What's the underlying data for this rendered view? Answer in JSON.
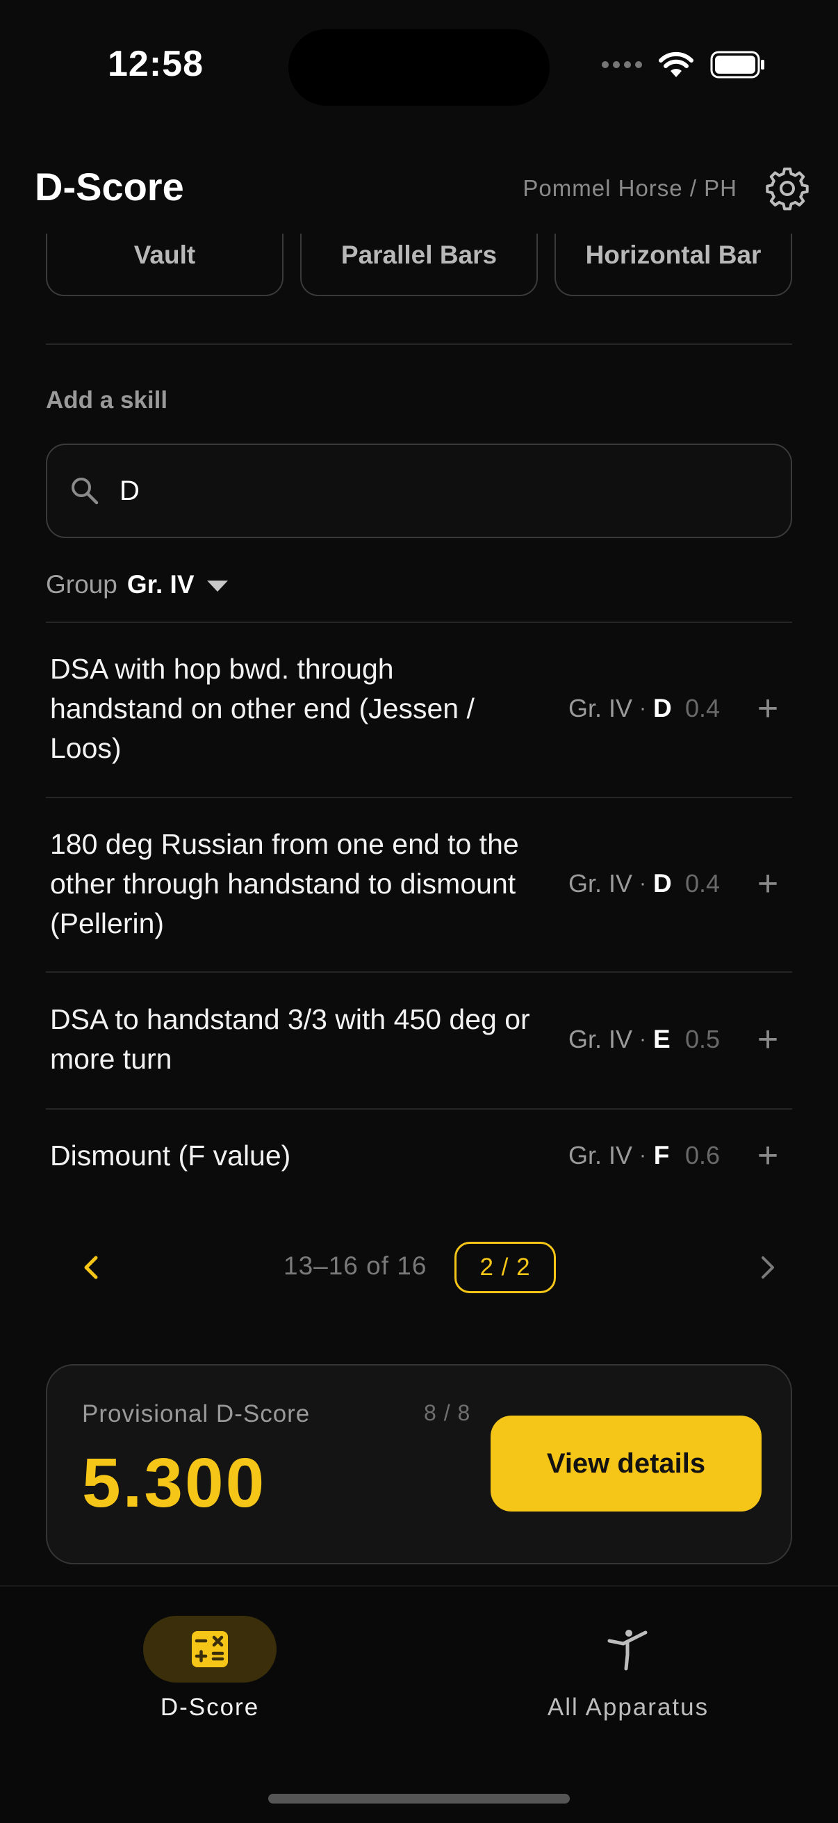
{
  "status_bar": {
    "time": "12:58"
  },
  "header": {
    "title": "D-Score",
    "apparatus": "Pommel Horse / PH"
  },
  "apparatus_tabs": [
    "Vault",
    "Parallel Bars",
    "Horizontal Bar"
  ],
  "add_skill": {
    "label": "Add a skill",
    "search_value": "D",
    "group_label": "Group",
    "group_value": "Gr. IV"
  },
  "skills": [
    {
      "name": "DSA with hop bwd. through handstand on other end (Jessen / Loos)",
      "group": "Gr. IV",
      "sep": "·",
      "value": "D",
      "points": "0.4",
      "add": "+"
    },
    {
      "name": "180 deg Russian from one end to the other through handstand to dismount (Pellerin)",
      "group": "Gr. IV",
      "sep": "·",
      "value": "D",
      "points": "0.4",
      "add": "+"
    },
    {
      "name": "DSA to handstand 3/3 with 450 deg or more turn",
      "group": "Gr. IV",
      "sep": "·",
      "value": "E",
      "points": "0.5",
      "add": "+"
    },
    {
      "name": "Dismount (F value)",
      "group": "Gr. IV",
      "sep": "·",
      "value": "F",
      "points": "0.6",
      "add": "+"
    }
  ],
  "pager": {
    "range": "13–16 of 16",
    "page": "2 / 2"
  },
  "score": {
    "label": "Provisional D-Score",
    "count": "8 / 8",
    "value": "5.300",
    "button": "View details"
  },
  "nav": {
    "items": [
      {
        "label": "D-Score",
        "icon": "calculator-icon",
        "active": true
      },
      {
        "label": "All Apparatus",
        "icon": "gymnast-icon",
        "active": false
      }
    ]
  },
  "colors": {
    "accent": "#f5c518",
    "background": "#0b0b0b",
    "card": "#141414",
    "border": "#3a3a3a"
  }
}
